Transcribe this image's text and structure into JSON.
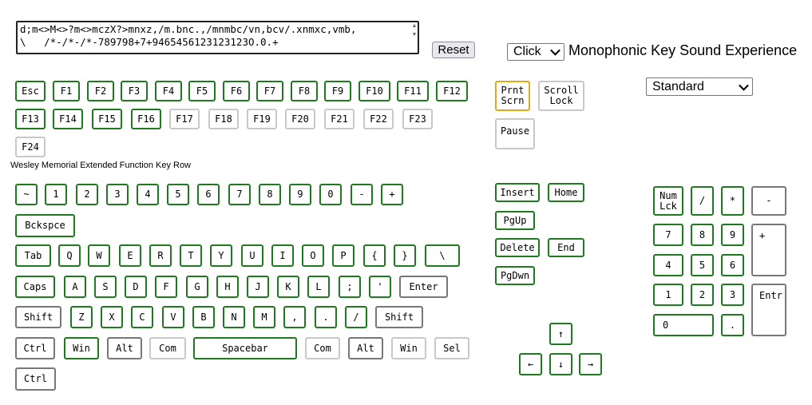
{
  "text_area": {
    "line1": "d;m<>M<>?m<>mczX?>mnxz,/m.bnc.,/mnmbc/vn,bcv/.xnmxc,vmb,",
    "line2": "\\   /*-/*-/*-789798+7+9465456123123123O.0.+"
  },
  "reset_label": "Reset",
  "sound_mode": {
    "selected": "Click"
  },
  "title": "Monophonic Key Sound Experience",
  "layout_select": {
    "selected": "Standard"
  },
  "extended_row_label": "Wesley Memorial Extended Function Key Row",
  "keys": {
    "esc": "Esc",
    "f1": "F1",
    "f2": "F2",
    "f3": "F3",
    "f4": "F4",
    "f5": "F5",
    "f6": "F6",
    "f7": "F7",
    "f8": "F8",
    "f9": "F9",
    "f10": "F10",
    "f11": "F11",
    "f12": "F12",
    "f13": "F13",
    "f14": "F14",
    "f15": "F15",
    "f16": "F16",
    "f17": "F17",
    "f18": "F18",
    "f19": "F19",
    "f20": "F20",
    "f21": "F21",
    "f22": "F22",
    "f23": "F23",
    "f24": "F24",
    "tilde": "~",
    "d1": "1",
    "d2": "2",
    "d3": "3",
    "d4": "4",
    "d5": "5",
    "d6": "6",
    "d7": "7",
    "d8": "8",
    "d9": "9",
    "d0": "0",
    "minus": "-",
    "plus": "+",
    "backspace": "Bckspce",
    "tab": "Tab",
    "q": "Q",
    "w": "W",
    "e": "E",
    "r": "R",
    "t": "T",
    "y": "Y",
    "u": "U",
    "i": "I",
    "o": "O",
    "p": "P",
    "lbrace": "{",
    "rbrace": "}",
    "backslash": "\\",
    "caps": "Caps",
    "a": "A",
    "s": "S",
    "d": "D",
    "f": "F",
    "g": "G",
    "h": "H",
    "j": "J",
    "k": "K",
    "l": "L",
    "semicolon": ";",
    "quote": "'",
    "enter": "Enter",
    "shift_l": "Shift",
    "z": "Z",
    "x": "X",
    "c": "C",
    "v": "V",
    "b": "B",
    "n": "N",
    "m": "M",
    "comma": ",",
    "period": ".",
    "slash": "/",
    "shift_r": "Shift",
    "ctrl_l": "Ctrl",
    "win_l": "Win",
    "alt_l": "Alt",
    "com_l": "Com",
    "spacebar": "Spacebar",
    "com_r": "Com",
    "alt_r": "Alt",
    "win_r": "Win",
    "sel": "Sel",
    "ctrl_r": "Ctrl",
    "prnt_scrn": "Prnt\nScrn",
    "scroll_lock": "Scroll\nLock",
    "pause": "Pause",
    "insert": "Insert",
    "home": "Home",
    "pgup": "PgUp",
    "delete": "Delete",
    "end": "End",
    "pgdwn": "PgDwn",
    "arrow_up": "↑",
    "arrow_left": "←",
    "arrow_down": "↓",
    "arrow_right": "→",
    "num_lock": "Num\nLck",
    "np_slash": "/",
    "np_star": "*",
    "np_minus": "-",
    "np7": "7",
    "np8": "8",
    "np9": "9",
    "np_plus": "+",
    "np4": "4",
    "np5": "5",
    "np6": "6",
    "np1": "1",
    "np2": "2",
    "np3": "3",
    "np_enter": "Entr",
    "np0": "0",
    "np_dot": "."
  },
  "colors": {
    "key_border_active": "#1f7a1f",
    "key_border_inactive": "#c8c8c8",
    "key_border_dark": "#777777",
    "key_border_highlight": "#e6a817"
  }
}
